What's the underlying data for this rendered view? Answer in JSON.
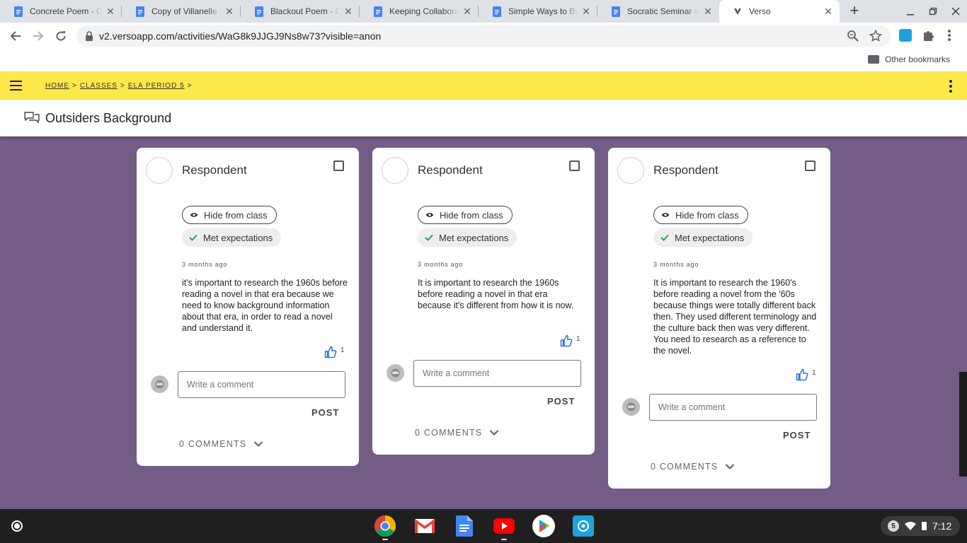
{
  "browser": {
    "tabs": [
      {
        "title": "Concrete Poem - Go",
        "icon": "google-docs-icon"
      },
      {
        "title": "Copy of Villanelle W",
        "icon": "google-docs-icon"
      },
      {
        "title": "Blackout Poem - Go",
        "icon": "google-docs-icon"
      },
      {
        "title": "Keeping Collaborat",
        "icon": "google-docs-icon"
      },
      {
        "title": "Simple Ways to Bui",
        "icon": "google-docs-icon"
      },
      {
        "title": "Socratic Seminar =",
        "icon": "google-docs-icon"
      },
      {
        "title": "Verso",
        "icon": "verso-icon",
        "active": true
      }
    ],
    "url": "v2.versoapp.com/activities/WaG8k9JJGJ9Ns8w73?visible=anon",
    "bookmarks": {
      "other": "Other bookmarks"
    }
  },
  "app": {
    "breadcrumbs": [
      "HOME",
      "CLASSES",
      "ELA PERIOD 5"
    ],
    "crumb_sep": ">",
    "title": "Outsiders Background",
    "colors": {
      "header": "#fde84a",
      "background": "#735c85",
      "like": "#2f6fdb",
      "check": "#2e9e4a"
    }
  },
  "cards": [
    {
      "respondent": "Respondent",
      "hide_label": "Hide from class",
      "met_label": "Met expectations",
      "time": "3 months ago",
      "body": "it's important to research the 1960s before reading a novel in that era because we need to know background information about that era, in order to read a novel and understand it.",
      "likes": "1",
      "comment_placeholder": "Write a comment",
      "post_label": "POST",
      "comments_label": "0 COMMENTS"
    },
    {
      "respondent": "Respondent",
      "hide_label": "Hide from class",
      "met_label": "Met expectations",
      "time": "3 months ago",
      "body": "It is important to research the 1960s before reading a novel in that era because it's different from how it is now.",
      "likes": "1",
      "comment_placeholder": "Write a comment",
      "post_label": "POST",
      "comments_label": "0 COMMENTS"
    },
    {
      "respondent": "Respondent",
      "hide_label": "Hide from class",
      "met_label": "Met expectations",
      "time": "3 months ago",
      "body": "It is important to research the 1960's before reading a novel from the '60s because things were totally different back then. They used different terminology and the culture back then was very different. You need to research as a reference to the novel.",
      "likes": "1",
      "comment_placeholder": "Write a comment",
      "post_label": "POST",
      "comments_label": "0 COMMENTS"
    }
  ],
  "shelf": {
    "apps": [
      "chrome-icon",
      "gmail-icon",
      "google-docs-icon",
      "youtube-icon",
      "play-store-icon",
      "screencastify-icon"
    ],
    "notification_count": "5",
    "time": "7:12"
  }
}
